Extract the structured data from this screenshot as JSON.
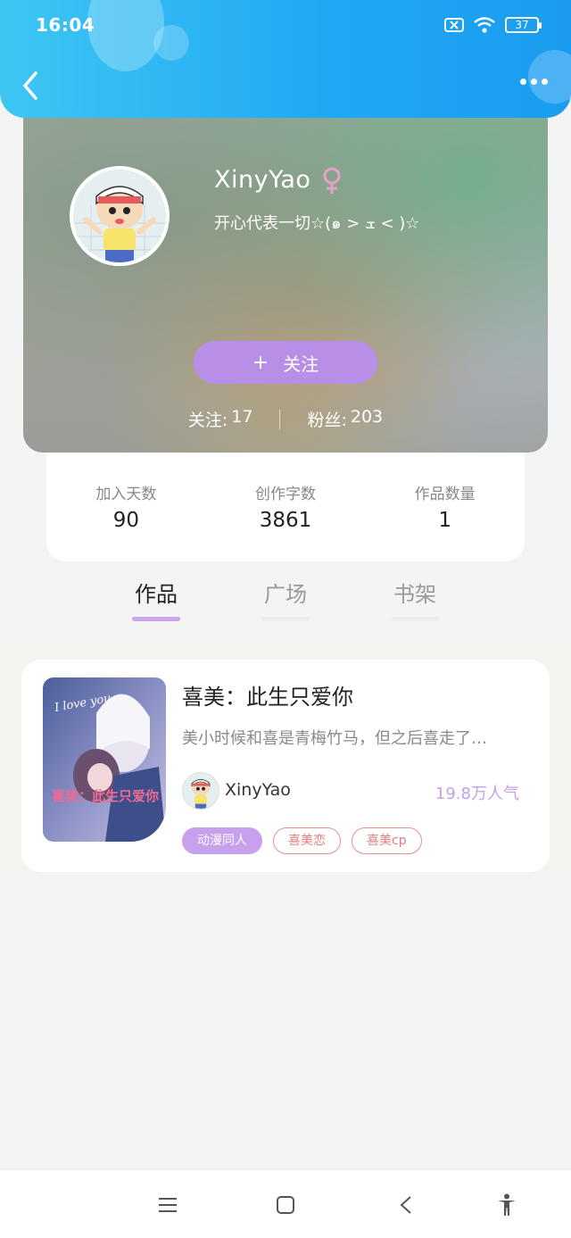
{
  "status_bar": {
    "time": "16:04",
    "battery": "37"
  },
  "profile": {
    "name": "XinyYao",
    "bio": "开心代表一切☆(๑ > ܫ < )☆",
    "follow_label": "关注",
    "follow_plus": "+",
    "following_label": "关注:",
    "following_count": "17",
    "fans_label": "粉丝:",
    "fans_count": "203"
  },
  "stats": [
    {
      "label": "加入天数",
      "value": "90"
    },
    {
      "label": "创作字数",
      "value": "3861"
    },
    {
      "label": "作品数量",
      "value": "1"
    }
  ],
  "tabs": [
    {
      "label": "作品",
      "active": true
    },
    {
      "label": "广场",
      "active": false
    },
    {
      "label": "书架",
      "active": false
    }
  ],
  "book": {
    "title": "喜美：此生只爱你",
    "description": "美小时候和喜是青梅竹马，但之后喜走了…",
    "author": "XinyYao",
    "popularity": "19.8万人气",
    "cover_text": "喜美：此生只爱你",
    "tags": [
      {
        "label": "动漫同人",
        "style": "filled"
      },
      {
        "label": "喜美恋",
        "style": "outline"
      },
      {
        "label": "喜美cp",
        "style": "outline"
      }
    ]
  },
  "colors": {
    "header_blue": "#1ea7f3",
    "accent_purple": "#b88fe6",
    "tag_red": "#e07e7e",
    "female_icon": "#e8a0c8"
  },
  "icons": {
    "back": "chevron-left-icon",
    "more": "more-dots-icon",
    "gender": "female-icon",
    "nav": [
      "menu-icon",
      "home-square-icon",
      "back-triangle-icon",
      "accessibility-icon"
    ]
  }
}
